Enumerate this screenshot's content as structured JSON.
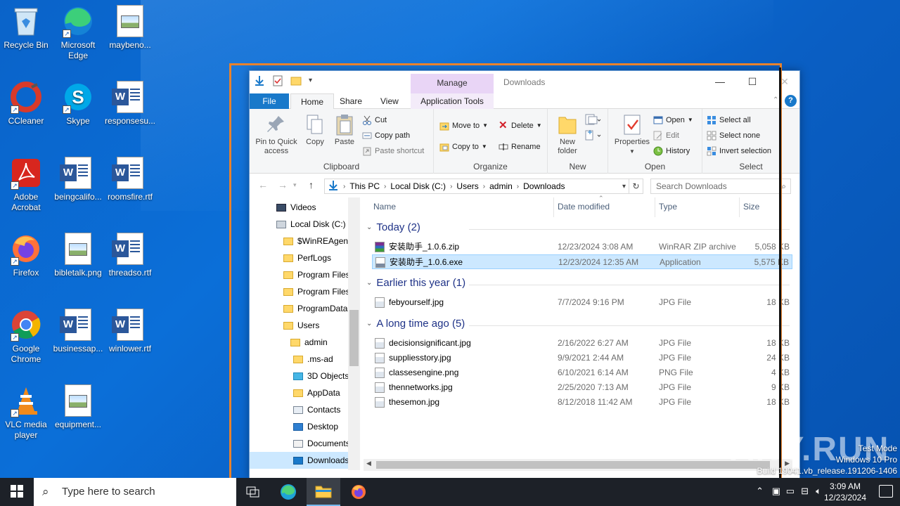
{
  "desktop": {
    "icons": [
      {
        "label": "Recycle Bin",
        "icon": "recycle-bin-icon"
      },
      {
        "label": "Microsoft Edge",
        "icon": "edge-icon"
      },
      {
        "label": "maybeno...",
        "icon": "image-file-icon"
      },
      {
        "label": "CCleaner",
        "icon": "ccleaner-icon"
      },
      {
        "label": "Skype",
        "icon": "skype-icon"
      },
      {
        "label": "responsesu...",
        "icon": "word-doc-icon"
      },
      {
        "label": "Adobe Acrobat",
        "icon": "acrobat-icon"
      },
      {
        "label": "beingcalifo...",
        "icon": "word-doc-icon"
      },
      {
        "label": "roomsfire.rtf",
        "icon": "word-doc-icon"
      },
      {
        "label": "Firefox",
        "icon": "firefox-icon"
      },
      {
        "label": "bibletalk.png",
        "icon": "image-file-icon"
      },
      {
        "label": "threadso.rtf",
        "icon": "word-doc-icon"
      },
      {
        "label": "Google Chrome",
        "icon": "chrome-icon"
      },
      {
        "label": "businessap...",
        "icon": "word-doc-icon"
      },
      {
        "label": "winlower.rtf",
        "icon": "word-doc-icon"
      },
      {
        "label": "VLC media player",
        "icon": "vlc-icon"
      },
      {
        "label": "equipment...",
        "icon": "image-file-icon"
      }
    ]
  },
  "window": {
    "title": "Downloads",
    "manage_tab": "Manage",
    "tabs": {
      "file": "File",
      "home": "Home",
      "share": "Share",
      "view": "View",
      "app_tools": "Application Tools"
    },
    "ribbon": {
      "clipboard": {
        "label": "Clipboard",
        "pin": "Pin to Quick access",
        "copy": "Copy",
        "paste": "Paste",
        "cut": "Cut",
        "copy_path": "Copy path",
        "paste_shortcut": "Paste shortcut"
      },
      "organize": {
        "label": "Organize",
        "move_to": "Move to",
        "copy_to": "Copy to",
        "delete": "Delete",
        "rename": "Rename"
      },
      "new": {
        "label": "New",
        "new_folder": "New folder"
      },
      "open": {
        "label": "Open",
        "properties": "Properties",
        "open": "Open",
        "edit": "Edit",
        "history": "History"
      },
      "select": {
        "label": "Select",
        "select_all": "Select all",
        "select_none": "Select none",
        "invert": "Invert selection"
      }
    },
    "address": {
      "crumbs": [
        "This PC",
        "Local Disk (C:)",
        "Users",
        "admin",
        "Downloads"
      ]
    },
    "search_placeholder": "Search Downloads",
    "nav": [
      {
        "label": "Videos",
        "indent": 1
      },
      {
        "label": "Local Disk (C:)",
        "indent": 1
      },
      {
        "label": "$WinREAgent",
        "indent": 2
      },
      {
        "label": "PerfLogs",
        "indent": 2
      },
      {
        "label": "Program Files",
        "indent": 2
      },
      {
        "label": "Program Files",
        "indent": 2
      },
      {
        "label": "ProgramData",
        "indent": 2
      },
      {
        "label": "Users",
        "indent": 2
      },
      {
        "label": "admin",
        "indent": 3
      },
      {
        "label": ".ms-ad",
        "indent": 4
      },
      {
        "label": "3D Objects",
        "indent": 4
      },
      {
        "label": "AppData",
        "indent": 4
      },
      {
        "label": "Contacts",
        "indent": 4
      },
      {
        "label": "Desktop",
        "indent": 4
      },
      {
        "label": "Documents",
        "indent": 4
      },
      {
        "label": "Downloads",
        "indent": 4
      }
    ],
    "columns": {
      "name": "Name",
      "date": "Date modified",
      "type": "Type",
      "size": "Size"
    },
    "groups": [
      {
        "title": "Today (2)",
        "files": [
          {
            "name": "安装助手_1.0.6.zip",
            "date": "12/23/2024 3:08 AM",
            "type": "WinRAR ZIP archive",
            "size": "5,058 KB",
            "selected": false
          },
          {
            "name": "安装助手_1.0.6.exe",
            "date": "12/23/2024 12:35 AM",
            "type": "Application",
            "size": "5,575 KB",
            "selected": true
          }
        ]
      },
      {
        "title": "Earlier this year (1)",
        "files": [
          {
            "name": "febyourself.jpg",
            "date": "7/7/2024 9:16 PM",
            "type": "JPG File",
            "size": "18 KB",
            "selected": false
          }
        ]
      },
      {
        "title": "A long time ago (5)",
        "files": [
          {
            "name": "decisionsignificant.jpg",
            "date": "2/16/2022 6:27 AM",
            "type": "JPG File",
            "size": "18 KB",
            "selected": false
          },
          {
            "name": "suppliesstory.jpg",
            "date": "9/9/2021 2:44 AM",
            "type": "JPG File",
            "size": "24 KB",
            "selected": false
          },
          {
            "name": "classesengine.png",
            "date": "6/10/2021 6:14 AM",
            "type": "PNG File",
            "size": "4 KB",
            "selected": false
          },
          {
            "name": "thennetworks.jpg",
            "date": "2/25/2020 7:13 AM",
            "type": "JPG File",
            "size": "9 KB",
            "selected": false
          },
          {
            "name": "thesemon.jpg",
            "date": "8/12/2018 11:42 AM",
            "type": "JPG File",
            "size": "18 KB",
            "selected": false
          }
        ]
      }
    ]
  },
  "watermark": {
    "text": "ANY.RUN",
    "line1": "Test Mode",
    "line2": "Windows 10 Pro",
    "line3": "Build 19041.vb_release.191206-1406"
  },
  "taskbar": {
    "search_placeholder": "Type here to search",
    "time": "3:09 AM",
    "date": "12/23/2024",
    "pinned": [
      "task-view-icon",
      "edge-icon",
      "file-explorer-icon",
      "firefox-icon"
    ]
  },
  "colors": {
    "accent": "#1979ca",
    "selection": "#cce8ff",
    "manage": "#e9d5f6",
    "frame": "#e8822c"
  }
}
